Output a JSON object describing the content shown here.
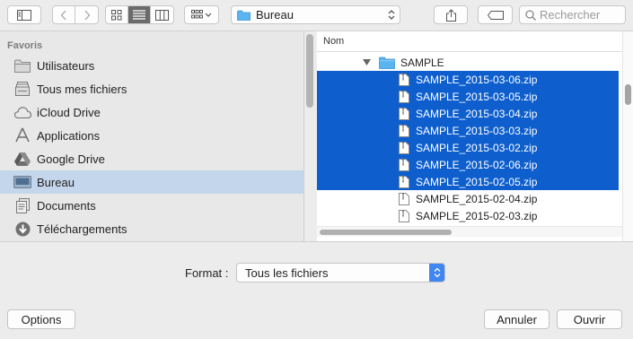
{
  "toolbar": {
    "location": "Bureau",
    "search_placeholder": "Rechercher",
    "icons": [
      "sidebar-toggle-icon",
      "chevron-left-icon",
      "chevron-right-icon",
      "icon-view-icon",
      "list-view-icon",
      "column-view-icon",
      "group-view-icon",
      "folder-icon",
      "share-icon",
      "tag-icon",
      "search-icon"
    ]
  },
  "sidebar": {
    "section_title": "Favoris",
    "items": [
      {
        "label": "Utilisateurs",
        "icon": "folder-icon"
      },
      {
        "label": "Tous mes fichiers",
        "icon": "all-files-icon"
      },
      {
        "label": "iCloud Drive",
        "icon": "cloud-icon"
      },
      {
        "label": "Applications",
        "icon": "applications-icon"
      },
      {
        "label": "Google Drive",
        "icon": "google-drive-icon"
      },
      {
        "label": "Bureau",
        "icon": "desktop-icon",
        "selected": true
      },
      {
        "label": "Documents",
        "icon": "document-icon"
      },
      {
        "label": "Téléchargements",
        "icon": "download-icon"
      }
    ]
  },
  "filelist": {
    "column_name": "Nom",
    "folder": "SAMPLE",
    "files": [
      {
        "name": "SAMPLE_2015-03-06.zip",
        "selected": true
      },
      {
        "name": "SAMPLE_2015-03-05.zip",
        "selected": true
      },
      {
        "name": "SAMPLE_2015-03-04.zip",
        "selected": true
      },
      {
        "name": "SAMPLE_2015-03-03.zip",
        "selected": true
      },
      {
        "name": "SAMPLE_2015-03-02.zip",
        "selected": true
      },
      {
        "name": "SAMPLE_2015-02-06.zip",
        "selected": true
      },
      {
        "name": "SAMPLE_2015-02-05.zip",
        "selected": true
      },
      {
        "name": "SAMPLE_2015-02-04.zip",
        "selected": false
      },
      {
        "name": "SAMPLE_2015-02-03.zip",
        "selected": false
      }
    ]
  },
  "format": {
    "label": "Format :",
    "value": "Tous les fichiers"
  },
  "buttons": {
    "options": "Options",
    "cancel": "Annuler",
    "open": "Ouvrir"
  },
  "colors": {
    "selection": "#0e5fcd",
    "sidebar_selection": "#c4d6ec",
    "folder": "#5ab4f0",
    "accent": "#3f86f3"
  }
}
